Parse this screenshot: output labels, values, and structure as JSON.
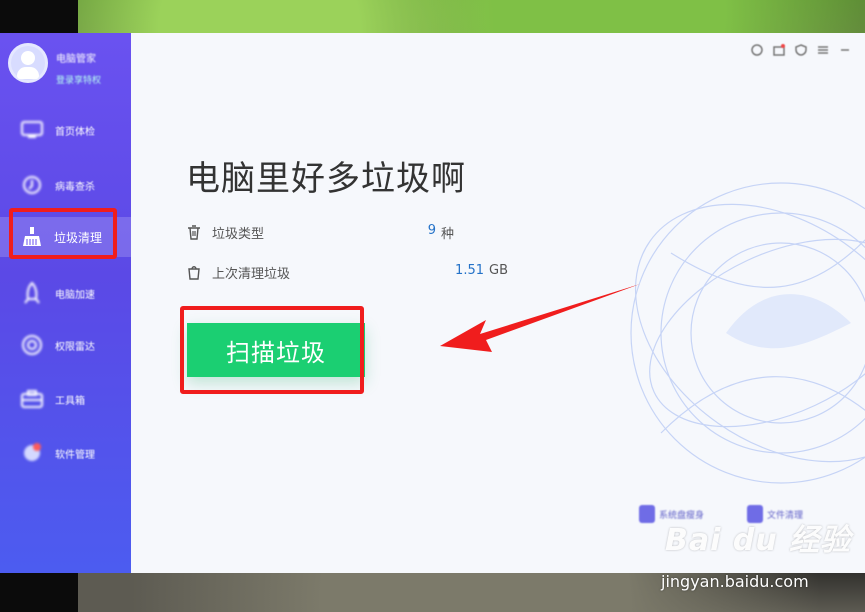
{
  "profile": {
    "name": "电脑管家",
    "subtitle": "登录享特权"
  },
  "sidebar": {
    "items": [
      {
        "label": "首页体检",
        "icon": "monitor-icon"
      },
      {
        "label": "病毒查杀",
        "icon": "shield-icon"
      },
      {
        "label": "垃圾清理",
        "icon": "broom-icon"
      },
      {
        "label": "电脑加速",
        "icon": "rocket-icon"
      },
      {
        "label": "权限雷达",
        "icon": "radar-icon"
      },
      {
        "label": "工具箱",
        "icon": "toolbox-icon"
      },
      {
        "label": "软件管理",
        "icon": "apps-icon"
      }
    ]
  },
  "main": {
    "title": "电脑里好多垃圾啊",
    "stats": [
      {
        "label": "垃圾类型",
        "value": "9",
        "unit": "种",
        "icon": "trash-icon"
      },
      {
        "label": "上次清理垃圾",
        "value": "1.51",
        "unit": "GB",
        "icon": "clean-bag-icon"
      }
    ],
    "scan_button": "扫描垃圾"
  },
  "bottom_links": [
    {
      "label": "系统盘瘦身",
      "icon": "disk-icon"
    },
    {
      "label": "文件清理",
      "icon": "file-icon"
    }
  ],
  "watermark": {
    "logo": "Bai du 经验",
    "url": "jingyan.baidu.com"
  },
  "colors": {
    "sidebar": "#5b49e6",
    "accent_green": "#1bcf72",
    "value_blue": "#2472c8",
    "annotation_red": "#f01d1d"
  }
}
